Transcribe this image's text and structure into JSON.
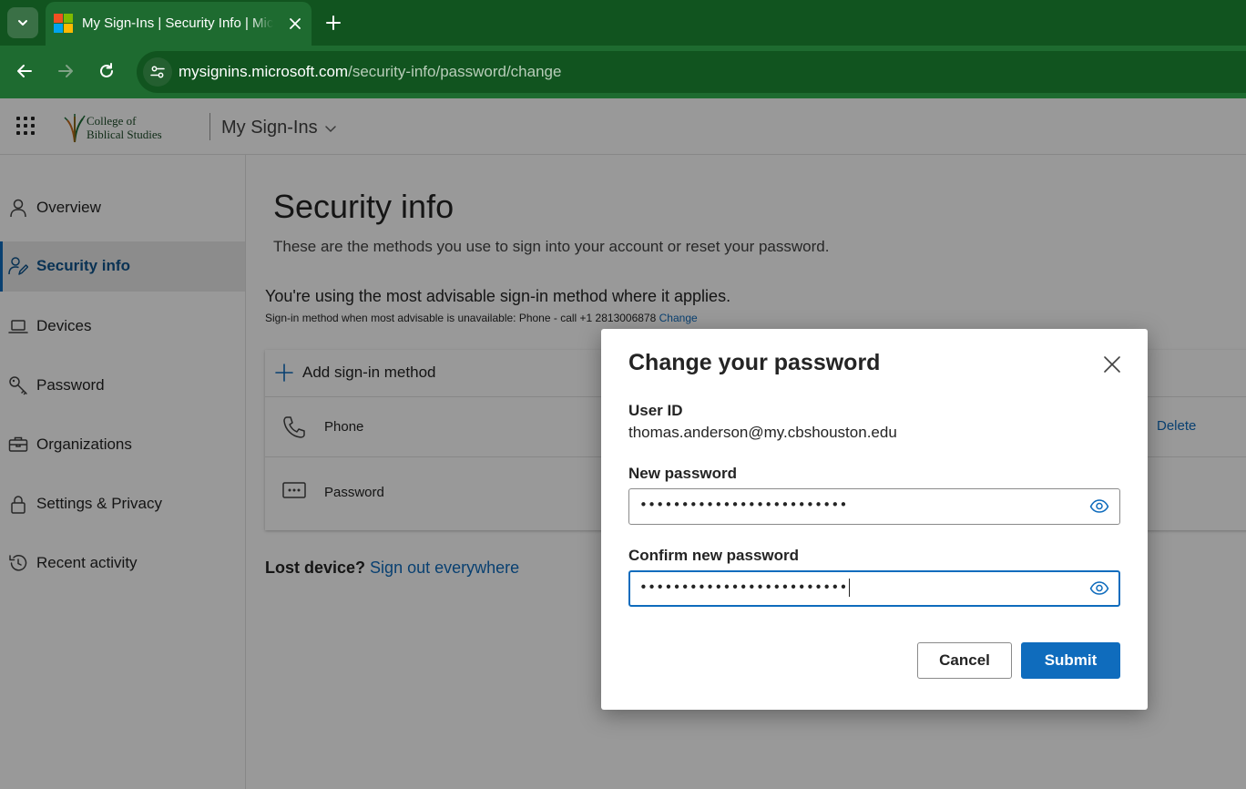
{
  "browser": {
    "tab_title": "My Sign-Ins | Security Info | Microsoft",
    "url_host": "mysignins.microsoft.com",
    "url_path": "/security-info/password/change"
  },
  "header": {
    "logo_text": "College of\nBiblical Studies",
    "app_name": "My Sign-Ins"
  },
  "sidebar": {
    "items": [
      {
        "label": "Overview",
        "icon": "person-icon"
      },
      {
        "label": "Security info",
        "icon": "security-info-icon",
        "selected": true
      },
      {
        "label": "Devices",
        "icon": "laptop-icon"
      },
      {
        "label": "Password",
        "icon": "key-icon"
      },
      {
        "label": "Organizations",
        "icon": "briefcase-icon"
      },
      {
        "label": "Settings & Privacy",
        "icon": "lock-icon"
      },
      {
        "label": "Recent activity",
        "icon": "history-icon"
      }
    ]
  },
  "main": {
    "title": "Security info",
    "description": "These are the methods you use to sign into your account or reset your password.",
    "advisable": "You're using the most advisable sign-in method where it applies.",
    "advisable_sub": "Sign-in method when most advisable is unavailable: Phone - call +1 2813006878",
    "change_link": "Change",
    "add_method": "Add sign-in method",
    "methods": [
      {
        "label": "Phone",
        "icon": "phone-icon",
        "action": "Delete"
      },
      {
        "label": "Password",
        "icon": "password-icon"
      }
    ],
    "lost_device_question": "Lost device?",
    "sign_out_link": "Sign out everywhere"
  },
  "dialog": {
    "title": "Change your password",
    "user_id_label": "User ID",
    "user_id_value": "thomas.anderson@my.cbshouston.edu",
    "new_password_label": "New password",
    "new_password_value": "•••••••••••••••••••••••••",
    "confirm_password_label": "Confirm new password",
    "confirm_password_value": "•••••••••••••••••••••••••",
    "cancel_label": "Cancel",
    "submit_label": "Submit"
  },
  "colors": {
    "accent": "#0f6cbd",
    "browser_frame": "#11541f",
    "browser_toolbar": "#1e6b30"
  }
}
